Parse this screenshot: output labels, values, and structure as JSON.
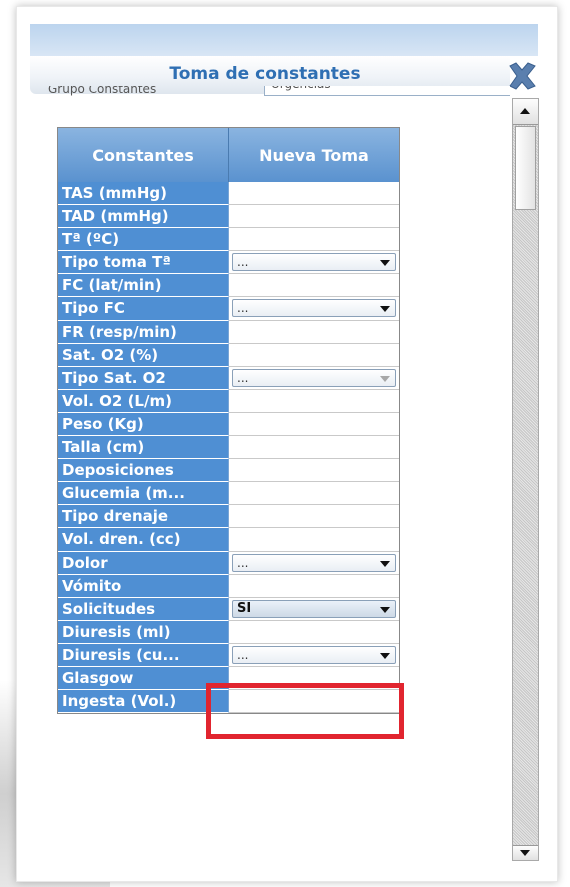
{
  "dialog": {
    "title": "Toma de constantes",
    "group_label": "Grupo Constantes",
    "group_value": "Urgencias"
  },
  "table": {
    "headers": [
      "Constantes",
      "Nueva Toma"
    ],
    "rows": [
      {
        "label": "TAS (mmHg)",
        "type": "text"
      },
      {
        "label": "TAD (mmHg)",
        "type": "text"
      },
      {
        "label": "Tª (ºC)",
        "type": "text"
      },
      {
        "label": "Tipo toma Tª",
        "type": "select",
        "value": "..."
      },
      {
        "label": "FC (lat/min)",
        "type": "text"
      },
      {
        "label": "Tipo FC",
        "type": "select",
        "value": "..."
      },
      {
        "label": "FR (resp/min)",
        "type": "text"
      },
      {
        "label": "Sat. O2 (%)",
        "type": "text"
      },
      {
        "label": "Tipo Sat. O2",
        "type": "select",
        "value": "...",
        "disabled": true
      },
      {
        "label": "Vol. O2 (L/m)",
        "type": "text"
      },
      {
        "label": "Peso (Kg)",
        "type": "text"
      },
      {
        "label": "Talla (cm)",
        "type": "text"
      },
      {
        "label": "Deposiciones",
        "type": "text"
      },
      {
        "label": "Glucemia (m...",
        "type": "text"
      },
      {
        "label": "Tipo drenaje",
        "type": "text"
      },
      {
        "label": "Vol. dren. (cc)",
        "type": "text"
      },
      {
        "label": "Dolor",
        "type": "select",
        "value": "..."
      },
      {
        "label": "Vómito",
        "type": "text"
      },
      {
        "label": "Solicitudes",
        "type": "select",
        "value": "SI",
        "selected": true
      },
      {
        "label": "Diuresis (ml)",
        "type": "text"
      },
      {
        "label": "Diuresis (cu...",
        "type": "select",
        "value": "..."
      },
      {
        "label": "Glasgow",
        "type": "text"
      },
      {
        "label": "Ingesta (Vol.)",
        "type": "text"
      }
    ]
  },
  "icons": {
    "close": "close-x-icon",
    "scroll_up": "arrow-up-icon",
    "scroll_down": "arrow-down-icon",
    "dropdown": "chevron-down-icon"
  },
  "colors": {
    "title": "#2f6fb3",
    "label_bg": "#4f8fd3",
    "highlight": "#e1252f"
  }
}
